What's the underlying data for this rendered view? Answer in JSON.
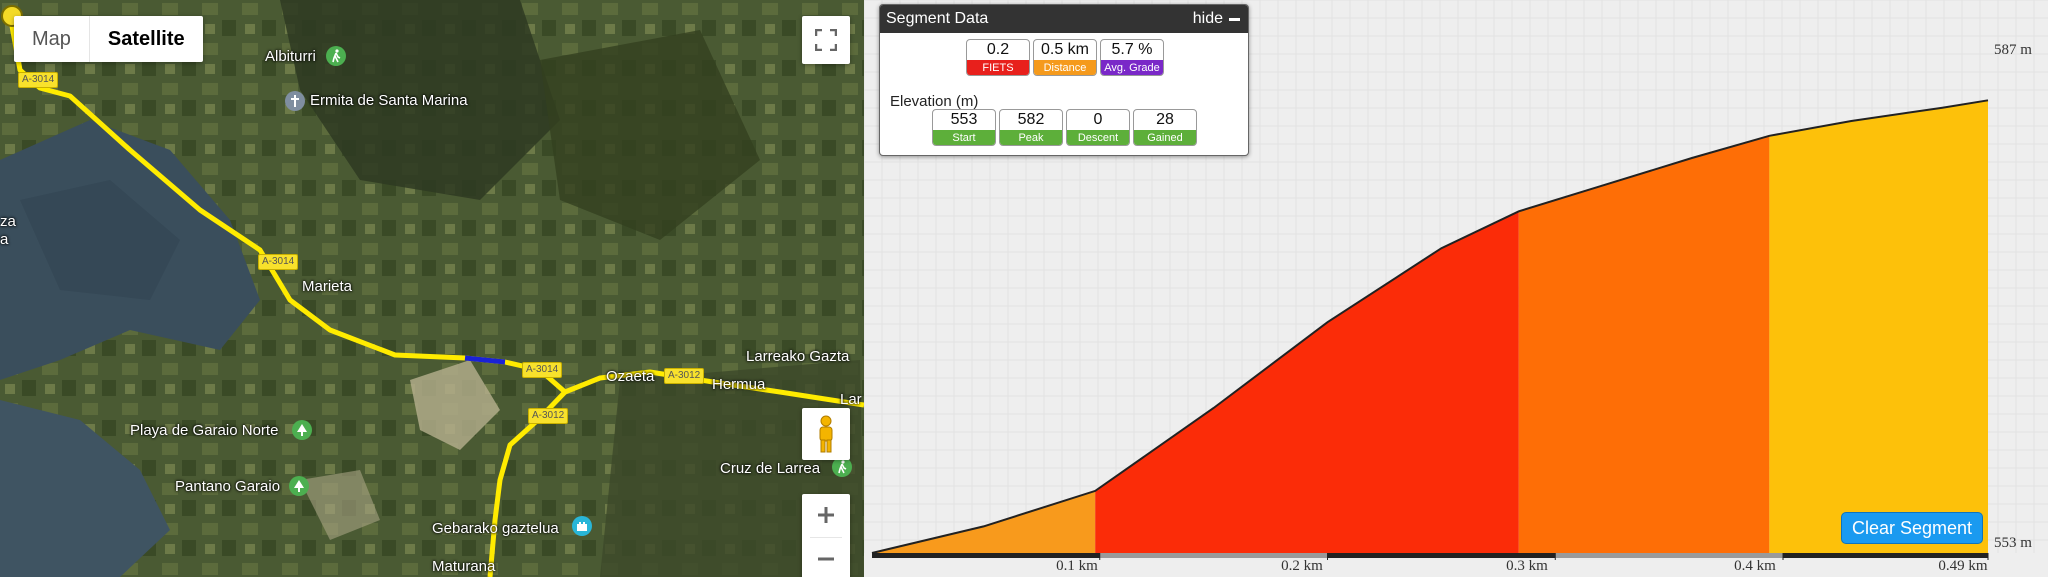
{
  "map": {
    "type_control": {
      "map_label": "Map",
      "satellite_label": "Satellite",
      "selected": "Satellite"
    },
    "places": [
      {
        "id": "albiturri",
        "label": "Albiturri"
      },
      {
        "id": "ermita",
        "label": "Ermita de Santa Marina"
      },
      {
        "id": "marieta",
        "label": "Marieta"
      },
      {
        "id": "larreako",
        "label": "Larreako Gazta"
      },
      {
        "id": "ozaeta",
        "label": "Ozaeta"
      },
      {
        "id": "hermua",
        "label": "Hermua"
      },
      {
        "id": "playa",
        "label": "Playa de Garaio Norte"
      },
      {
        "id": "pantano",
        "label": "Pantano Garaio"
      },
      {
        "id": "cruz",
        "label": "Cruz de Larrea"
      },
      {
        "id": "gebarako",
        "label": "Gebarako gaztelua"
      },
      {
        "id": "maturana",
        "label": "Maturana"
      },
      {
        "id": "edge-left",
        "label": "za"
      },
      {
        "id": "edge-left2",
        "label": "a"
      },
      {
        "id": "edge-right",
        "label": "Lar"
      }
    ],
    "road_shields": [
      "A-3014",
      "A-3014",
      "A-3014",
      "A-3012",
      "A-3012"
    ],
    "icons": {
      "fullscreen": "fullscreen-icon",
      "pegman": "pegman-icon",
      "zoom_in": "plus-icon",
      "zoom_out": "minus-icon"
    },
    "colors": {
      "route": "#ffeb00",
      "segment": "#1a22d6"
    }
  },
  "segment_data": {
    "title": "Segment Data",
    "hide_label": "hide",
    "stats": [
      {
        "value": "0.2",
        "label": "FIETS",
        "color": "#e8201c"
      },
      {
        "value": "0.5 km",
        "label": "Distance",
        "color": "#f59a1c"
      },
      {
        "value": "5.7 %",
        "label": "Avg. Grade",
        "color": "#7a28c8"
      }
    ],
    "elevation_title": "Elevation (m)",
    "elevation_stats": [
      {
        "value": "553",
        "label": "Start",
        "color": "#5daf3a"
      },
      {
        "value": "582",
        "label": "Peak",
        "color": "#5daf3a"
      },
      {
        "value": "0",
        "label": "Descent",
        "color": "#5daf3a"
      },
      {
        "value": "28",
        "label": "Gained",
        "color": "#5daf3a"
      }
    ]
  },
  "chart_data": {
    "type": "area",
    "ylabels": [
      "587 m",
      "553 m"
    ],
    "ylim": [
      553,
      587
    ],
    "xlim": [
      0,
      0.49
    ],
    "x": [
      0,
      0.049,
      0.098,
      0.15,
      0.2,
      0.25,
      0.284,
      0.32,
      0.36,
      0.394,
      0.43,
      0.47,
      0.49
    ],
    "y": [
      553,
      554.8,
      557.2,
      562.8,
      568.6,
      573.6,
      576.1,
      577.8,
      579.7,
      581.2,
      582.2,
      583.1,
      583.6
    ],
    "xticks": [
      {
        "value": 0.1,
        "label": "0.1 km"
      },
      {
        "value": 0.2,
        "label": "0.2 km"
      },
      {
        "value": 0.3,
        "label": "0.3 km"
      },
      {
        "value": 0.4,
        "label": "0.4 km"
      },
      {
        "value": 0.49,
        "label": "0.49 km"
      }
    ],
    "grade_bands": [
      {
        "from": 0,
        "to": 0.098,
        "color": "#f89a1c"
      },
      {
        "from": 0.098,
        "to": 0.284,
        "color": "#fb2c08"
      },
      {
        "from": 0.284,
        "to": 0.394,
        "color": "#fe6e06"
      },
      {
        "from": 0.394,
        "to": 0.49,
        "color": "#fdc10a"
      }
    ],
    "grid": true,
    "clear_label": "Clear Segment"
  }
}
